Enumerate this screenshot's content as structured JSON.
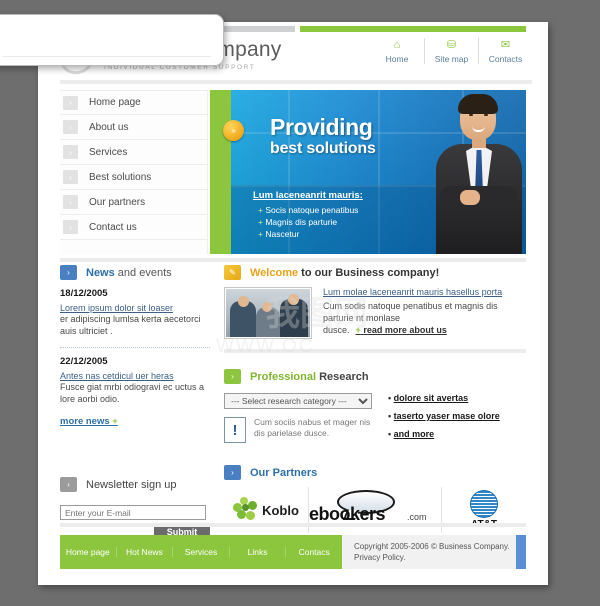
{
  "header": {
    "logo_name": "Business company",
    "logo_tagline": "INDIVIDUAL CUSTOMER SUPPORT",
    "nav": [
      {
        "label": "Home",
        "icon": "home-icon",
        "glyph": "⌂"
      },
      {
        "label": "Site map",
        "icon": "sitemap-icon",
        "glyph": "⛁"
      },
      {
        "label": "Contacts",
        "icon": "mail-icon",
        "glyph": "✉"
      }
    ]
  },
  "sidebar": {
    "items": [
      {
        "label": "Home page"
      },
      {
        "label": "About us"
      },
      {
        "label": "Services"
      },
      {
        "label": "Best solutions"
      },
      {
        "label": "Our partners"
      },
      {
        "label": "Contact us"
      }
    ],
    "arrow_glyph": "›"
  },
  "hero": {
    "badge_glyph": "»",
    "title": "Providing",
    "subtitle": "best solutions",
    "list_title": "Lum laceneanrit mauris:",
    "list": [
      "Socis natoque penatibus",
      "Magnis dis parturie",
      "Nascetur"
    ]
  },
  "news": {
    "title_bold": "News",
    "title_light": " and events",
    "icon_glyph": "›",
    "entries": [
      {
        "date": "18/12/2005",
        "link": "Lorem ipsum dolor sit loaser",
        "text": "er adipiscing  lumlsa kerta aecetorci auis ultriciet ."
      },
      {
        "date": "22/12/2005",
        "link": "Antes nas cetdicul uer heras",
        "text": "Fusce giat mrbi odiogravi ec uctus a lore aorbi odio."
      }
    ],
    "more_label": "more news",
    "more_plus": " +"
  },
  "newsletter": {
    "title": "Newsletter sign up",
    "icon_glyph": "›",
    "placeholder": "Enter your E-mail",
    "value": "",
    "submit_label": "Submit"
  },
  "welcome": {
    "icon_glyph": "✎",
    "title_bold": "Welcome",
    "title_light": " to our Business company!",
    "link": "Lum molae laceneanrit mauris hasellus porta",
    "body": "Cum sodis natoque penatibus et magnis dis parturie nt monlase dusce.",
    "read_more": "read more about us",
    "read_more_plus": "+"
  },
  "research": {
    "icon_glyph": "›",
    "title_bold": "Professional",
    "title_light": " Research",
    "select_value": "--- Select research category ---",
    "select_options": [
      "--- Select research category ---"
    ],
    "note_icon_glyph": "!",
    "note_text": "Cum sociis nabus et mager nis dis parielase dusce.",
    "links": [
      "dolore sit avertas",
      "taserto yaser mase olore",
      "and more"
    ]
  },
  "partners": {
    "icon_glyph": "›",
    "title": "Our Partners",
    "logos": [
      {
        "name": "Koblo",
        "type": "koblo"
      },
      {
        "name": "ebookers",
        "suffix": ".com",
        "type": "ebookers"
      },
      {
        "name": "AT&T",
        "type": "att"
      }
    ]
  },
  "footer": {
    "links": [
      "Home page",
      "Hot News",
      "Services",
      "Links",
      "Contacs"
    ],
    "copyright": "Copyright 2005-2006 © Business Company.",
    "privacy": "Privacy Policy."
  },
  "watermark": {
    "url_text": "WWW.OC",
    "cn_text": "我图网"
  },
  "colors": {
    "green": "#8cc63e",
    "blue": "#2f6fa8",
    "hero_blue": "#0f74c0",
    "orange": "#f0a81d",
    "page_bg": "#6e6e6e"
  }
}
